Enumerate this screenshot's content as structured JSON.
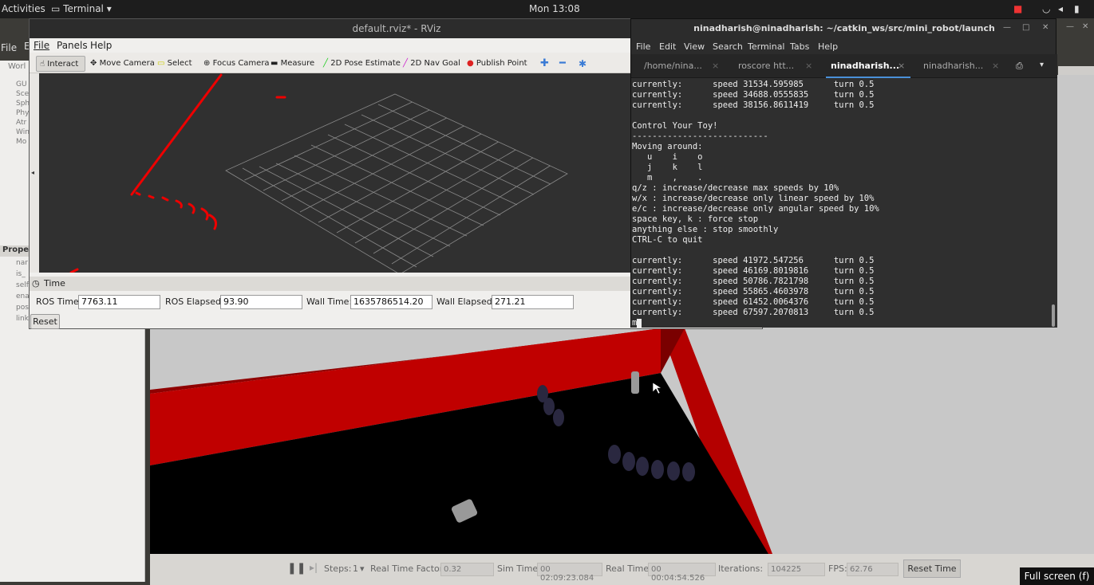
{
  "topbar": {
    "activities": "Activities",
    "terminal_menu": "Terminal",
    "clock": "Mon 13:08"
  },
  "gazebo": {
    "menu_file": "File",
    "menu_edit_partial": "E",
    "left_tab_partial": "Worl",
    "tree_items": [
      "GU",
      "Sce",
      "Sph",
      "Phy",
      "Atr",
      "Win",
      "Mo"
    ],
    "props_header": "Prope",
    "props_rows": [
      "nar",
      "is_",
      "self",
      "ena",
      "pos",
      "link"
    ],
    "bottom": {
      "steps_label": "Steps:",
      "steps_value": "1",
      "rtf_label": "Real Time Factor:",
      "rtf_value": "0.32",
      "simtime_label": "Sim Time:",
      "simtime_value": "00 02:09:23.084",
      "realtime_label": "Real Time:",
      "realtime_value": "00 00:04:54.526",
      "iterations_label": "Iterations:",
      "iterations_value": "104225",
      "fps_label": "FPS:",
      "fps_value": "62.76",
      "reset_time": "Reset Time"
    },
    "fullscreen_tip": "Full screen (f)"
  },
  "rviz": {
    "title": "default.rviz* - RViz",
    "menu": [
      "File",
      "Panels",
      "Help"
    ],
    "tools": [
      "Interact",
      "Move Camera",
      "Select",
      "Focus Camera",
      "Measure",
      "2D Pose Estimate",
      "2D Nav Goal",
      "Publish Point"
    ],
    "time_panel_title": "Time",
    "ros_time_label": "ROS Time:",
    "ros_time_value": "7763.11",
    "ros_elapsed_label": "ROS Elapsed:",
    "ros_elapsed_value": "93.90",
    "wall_time_label": "Wall Time:",
    "wall_time_value": "1635786514.20",
    "wall_elapsed_label": "Wall Elapsed:",
    "wall_elapsed_value": "271.21",
    "reset": "Reset"
  },
  "terminal": {
    "title": "ninadharish@ninadharish: ~/catkin_ws/src/mini_robot/launch",
    "menu": [
      "File",
      "Edit",
      "View",
      "Search",
      "Terminal",
      "Tabs",
      "Help"
    ],
    "tabs": [
      "/home/nina...",
      "roscore htt...",
      "ninadharish...",
      "ninadharish..."
    ],
    "lines": [
      "currently:      speed 31534.595985      turn 0.5",
      "currently:      speed 34688.0555835     turn 0.5",
      "currently:      speed 38156.8611419     turn 0.5",
      "",
      "Control Your Toy!",
      "---------------------------",
      "Moving around:",
      "   u    i    o",
      "   j    k    l",
      "   m    ,    .",
      "q/z : increase/decrease max speeds by 10%",
      "w/x : increase/decrease only linear speed by 10%",
      "e/c : increase/decrease only angular speed by 10%",
      "space key, k : force stop",
      "anything else : stop smoothly",
      "CTRL-C to quit",
      "",
      "currently:      speed 41972.547256      turn 0.5",
      "currently:      speed 46169.8019816     turn 0.5",
      "currently:      speed 50786.7821798     turn 0.5",
      "currently:      speed 55865.4603978     turn 0.5",
      "currently:      speed 61452.0064376     turn 0.5",
      "currently:      speed 67597.2070813     turn 0.5",
      "m"
    ]
  }
}
